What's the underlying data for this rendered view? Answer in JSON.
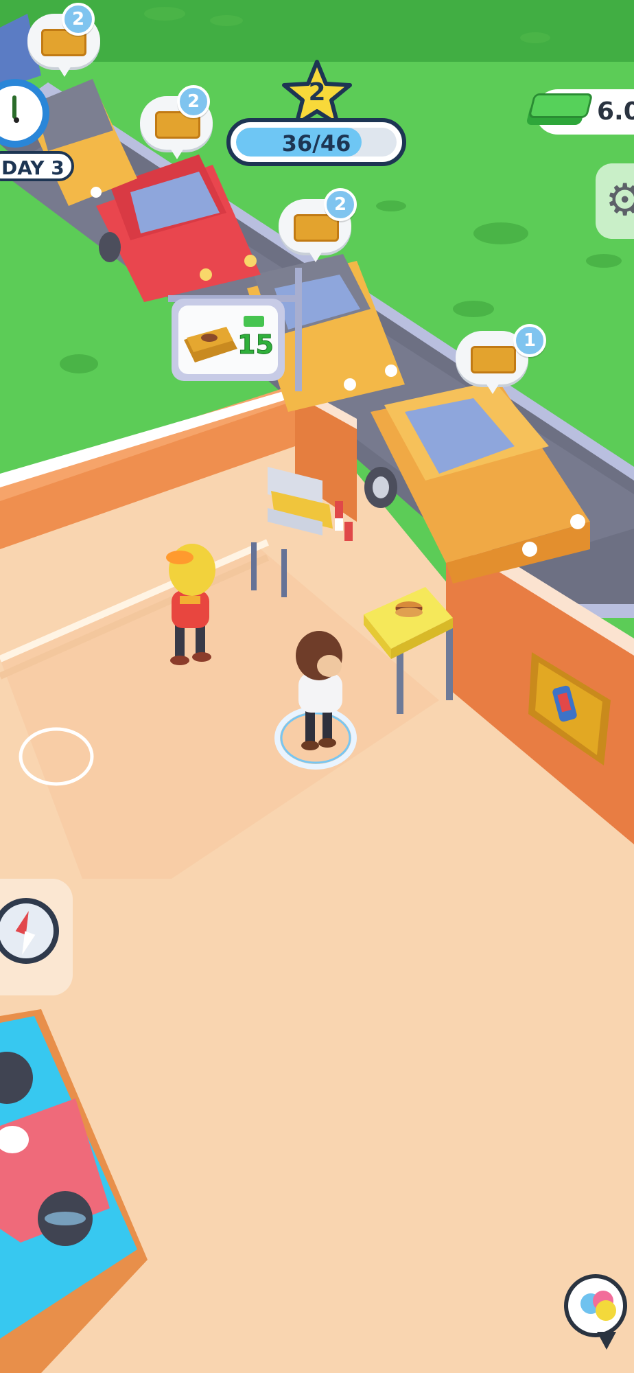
{
  "hud": {
    "day_label": "DAY 3",
    "level": "2",
    "xp_progress": "36/46",
    "xp_fraction": 0.78,
    "money": "6.0"
  },
  "orders": [
    {
      "count": "2"
    },
    {
      "count": "2"
    },
    {
      "count": "2"
    },
    {
      "count": "1"
    }
  ],
  "drive_thru_sign": {
    "price": "15"
  },
  "icons": {
    "timer": "alarm-clock-icon",
    "star": "star-icon",
    "cash": "cash-stack-icon",
    "settings": "gear-icon",
    "compass": "compass-icon",
    "chat": "chat-bubble-icon",
    "burger_box": "burger-box-icon"
  },
  "colors": {
    "grass": "#5ccc57",
    "floor": "#f9d5b0",
    "wall": "#ee8c4f",
    "xp_bar": "#6ec6f4"
  }
}
